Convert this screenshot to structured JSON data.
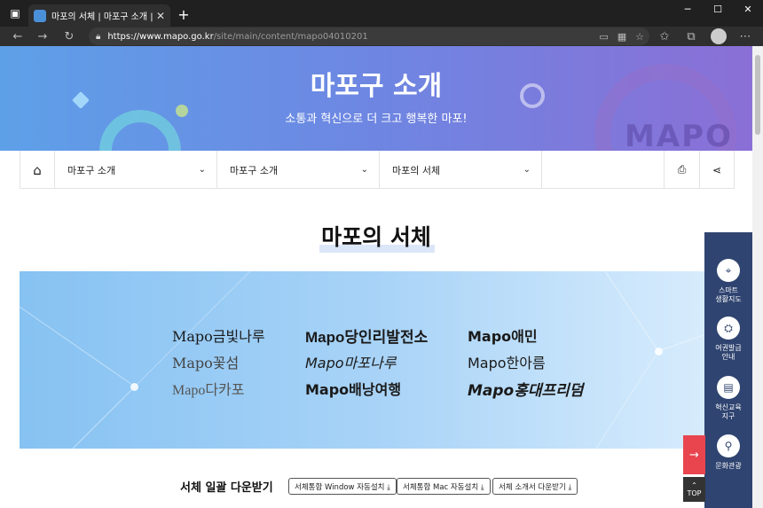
{
  "browser": {
    "tab_title": "마포의 서체 | 마포구 소개 | 마포",
    "tab_close": "✕",
    "new_tab": "+",
    "url_host": "https://www.mapo.go.kr",
    "url_path": "/site/main/content/mapo04010201"
  },
  "hero": {
    "title": "마포구 소개",
    "subtitle": "소통과 혁신으로 더 크고 행복한 마포!",
    "logo": "MAPO"
  },
  "breadcrumb": {
    "items": [
      {
        "label": "마포구 소개"
      },
      {
        "label": "마포구 소개"
      },
      {
        "label": "마포의 서체"
      }
    ]
  },
  "page": {
    "title": "마포의 서체"
  },
  "fonts": {
    "col1": [
      "Mapo금빛나루",
      "Mapo꽃섬",
      "Mapo다카포"
    ],
    "col2": [
      "Mapo당인리발전소",
      "Mapo마포나루",
      "Mapo배낭여행"
    ],
    "col3": [
      "Mapo애민",
      "Mapo한아름",
      "Mapo홍대프리덤"
    ]
  },
  "download": {
    "label": "서체 일괄 다운받기",
    "buttons": [
      {
        "label": "서체통합 Window 자동설치 ⤓"
      },
      {
        "label": "서체통합 Mac 자동설치 ⤓"
      },
      {
        "label": "서체 소개서 다운받기 ⤓"
      }
    ]
  },
  "quick_menu": {
    "items": [
      {
        "label_1": "스마트",
        "label_2": "생활지도",
        "icon": "map-pin-icon"
      },
      {
        "label_1": "여권발급",
        "label_2": "안내",
        "icon": "passport-icon"
      },
      {
        "label_1": "혁신교육",
        "label_2": "지구",
        "icon": "book-icon"
      },
      {
        "label_1": "문화관광",
        "label_2": "",
        "icon": "walker-icon"
      }
    ],
    "top_label": "TOP"
  },
  "colors": {
    "hero_start": "#5ea0e8",
    "hero_end": "#8a6fd6",
    "quick_menu_bg": "#2f4470",
    "accent_red": "#e8454f"
  }
}
